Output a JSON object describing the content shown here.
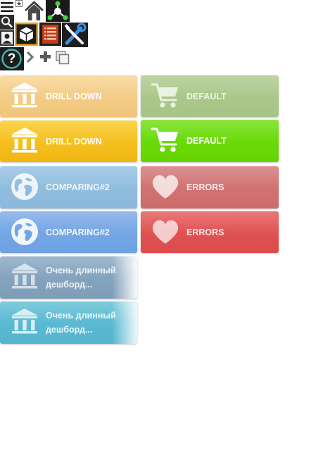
{
  "toolbar": {
    "icons": [
      "menu-icon",
      "star-marker-icon",
      "home-icon",
      "network-icon",
      "search-icon",
      "user-icon",
      "cube-icon",
      "list-icon",
      "tools-icon",
      "help-icon",
      "chevron-right-icon",
      "plus-icon",
      "copy-icon"
    ],
    "help_glyph": "?"
  },
  "tiles": [
    {
      "label": "DRILL DOWN",
      "icon": "bank-icon",
      "color": "#f4cd88",
      "state": "faded"
    },
    {
      "label": "DEFAULT",
      "icon": "cart-icon",
      "color": "#aac78a",
      "state": "faded"
    },
    {
      "label": "DRILL DOWN",
      "icon": "bank-icon",
      "color": "#f5bf1e",
      "state": "active"
    },
    {
      "label": "DEFAULT",
      "icon": "cart-icon",
      "color": "#6ad909",
      "state": "active"
    },
    {
      "label": "COMPARING#2",
      "icon": "globe-icon",
      "color": "#8fbcde",
      "state": "faded"
    },
    {
      "label": "ERRORS",
      "icon": "heart-icon",
      "color": "#d07070",
      "state": "faded"
    },
    {
      "label": "COMPARING#2",
      "icon": "globe-icon",
      "color": "#73a6e5",
      "state": "active"
    },
    {
      "label": "ERRORS",
      "icon": "heart-icon",
      "color": "#e05252",
      "state": "active"
    },
    {
      "label": "Очень длинный дешборд...",
      "icon": "bank-icon",
      "color": "#82a3be",
      "state": "faded"
    },
    {
      "label": "Очень длинный дешборд...",
      "icon": "bank-icon",
      "color": "#5abad2",
      "state": "active"
    }
  ]
}
